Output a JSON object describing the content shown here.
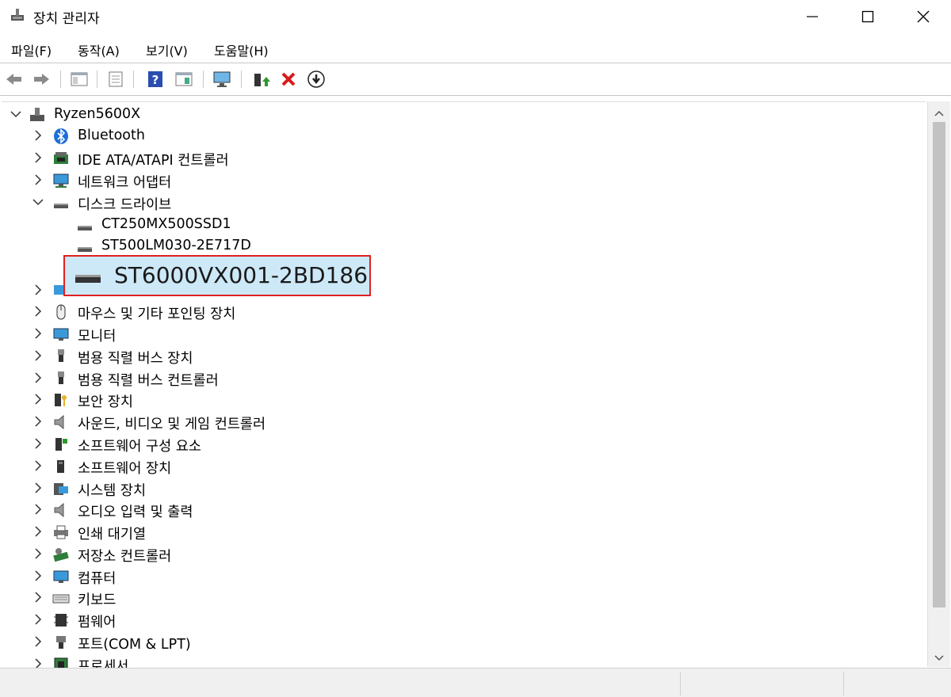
{
  "window": {
    "title": "장치 관리자",
    "controls": {
      "minimize": "—",
      "maximize": "☐",
      "close": "✕"
    }
  },
  "menu": [
    "파일(F)",
    "동작(A)",
    "보기(V)",
    "도움말(H)"
  ],
  "toolbar": [
    "back-icon",
    "forward-icon",
    "show-hide-console-tree-icon",
    "properties-icon",
    "help-icon",
    "action-pane-icon",
    "monitor-icon",
    "update-driver-icon",
    "uninstall-icon",
    "download-icon"
  ],
  "tree": {
    "root": "Ryzen5600X",
    "nodes": [
      {
        "label": "Bluetooth",
        "icon": "bluetooth-icon",
        "expanded": false
      },
      {
        "label": "IDE ATA/ATAPI 컨트롤러",
        "icon": "ide-controller-icon",
        "expanded": false
      },
      {
        "label": "네트워크 어댑터",
        "icon": "network-adapter-icon",
        "expanded": false
      },
      {
        "label": "디스크 드라이브",
        "icon": "disk-drive-icon",
        "expanded": true,
        "children": [
          "CT250MX500SSD1",
          "ST500LM030-2E717D",
          "ST6000VX001-2BD186"
        ]
      },
      {
        "label": "마우스 및 기타 포인팅 장치",
        "icon": "mouse-icon"
      },
      {
        "label": "모니터",
        "icon": "monitor-icon"
      },
      {
        "label": "범용 직렬 버스 장치",
        "icon": "usb-icon"
      },
      {
        "label": "범용 직렬 버스 컨트롤러",
        "icon": "usb-icon"
      },
      {
        "label": "보안 장치",
        "icon": "security-device-icon"
      },
      {
        "label": "사운드, 비디오 및 게임 컨트롤러",
        "icon": "speaker-icon"
      },
      {
        "label": "소프트웨어 구성 요소",
        "icon": "software-component-icon"
      },
      {
        "label": "소프트웨어 장치",
        "icon": "software-device-icon"
      },
      {
        "label": "시스템 장치",
        "icon": "system-device-icon"
      },
      {
        "label": "오디오 입력 및 출력",
        "icon": "speaker-icon"
      },
      {
        "label": "인쇄 대기열",
        "icon": "printer-icon"
      },
      {
        "label": "저장소 컨트롤러",
        "icon": "storage-controller-icon"
      },
      {
        "label": "컴퓨터",
        "icon": "computer-icon"
      },
      {
        "label": "키보드",
        "icon": "keyboard-icon"
      },
      {
        "label": "펌웨어",
        "icon": "firmware-icon"
      },
      {
        "label": "포트(COM & LPT)",
        "icon": "port-icon"
      },
      {
        "label": "프로세서",
        "icon": "processor-icon"
      }
    ]
  },
  "highlight": {
    "label": "ST6000VX001-2BD186",
    "border_color": "#e02020"
  }
}
